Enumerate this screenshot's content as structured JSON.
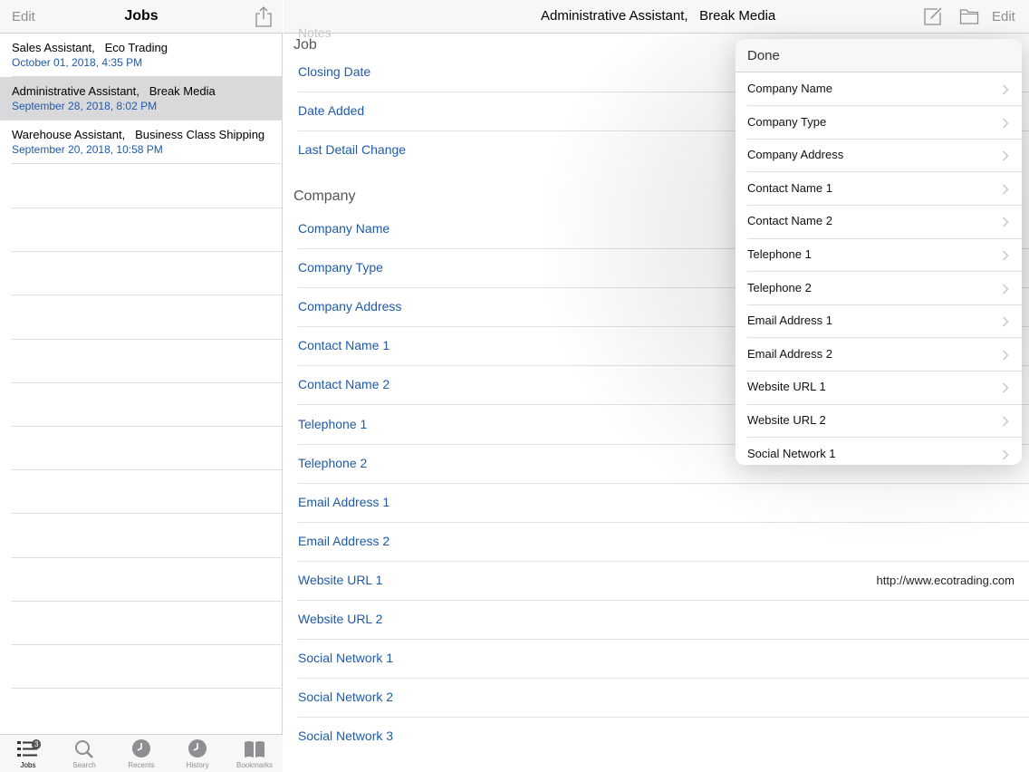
{
  "left": {
    "edit_label": "Edit",
    "title": "Jobs",
    "share_icon": "share-icon",
    "jobs": [
      {
        "title": "Sales Assistant,   Eco Trading",
        "date": "October 01, 2018, 4:35 PM",
        "selected": false
      },
      {
        "title": "Administrative Assistant,   Break Media",
        "date": "September 28, 2018, 8:02 PM",
        "selected": true
      },
      {
        "title": "Warehouse Assistant,   Business Class Shipping",
        "date": "September 20, 2018, 10:58 PM",
        "selected": false
      }
    ],
    "tabs": [
      {
        "label": "Jobs",
        "icon": "list-icon",
        "badge": "3",
        "active": true
      },
      {
        "label": "Search",
        "icon": "magnifier-icon",
        "active": false
      },
      {
        "label": "Recents",
        "icon": "clock-icon",
        "active": false
      },
      {
        "label": "History",
        "icon": "clock-icon",
        "active": false
      },
      {
        "label": "Bookmarks",
        "icon": "book-icon",
        "active": false
      }
    ]
  },
  "right": {
    "title": "Administrative Assistant,   Break Media",
    "edit_label": "Edit",
    "compose_icon": "compose-icon",
    "folder_icon": "folder-icon",
    "notes_ghost": "Notes",
    "sections": [
      {
        "header": "Job",
        "fields": [
          {
            "label": "Closing Date",
            "value": ""
          },
          {
            "label": "Date Added",
            "value": ""
          },
          {
            "label": "Last Detail Change",
            "value": ""
          }
        ]
      },
      {
        "header": "Company",
        "fields": [
          {
            "label": "Company Name",
            "value": ""
          },
          {
            "label": "Company Type",
            "value": ""
          },
          {
            "label": "Company Address",
            "value": ""
          },
          {
            "label": "Contact Name 1",
            "value": ""
          },
          {
            "label": "Contact Name 2",
            "value": ""
          },
          {
            "label": "Telephone 1",
            "value": ""
          },
          {
            "label": "Telephone 2",
            "value": ""
          },
          {
            "label": "Email Address 1",
            "value": ""
          },
          {
            "label": "Email Address 2",
            "value": ""
          },
          {
            "label": "Website URL 1",
            "value": "http://www.ecotrading.com"
          },
          {
            "label": "Website URL 2",
            "value": ""
          },
          {
            "label": "Social Network 1",
            "value": ""
          },
          {
            "label": "Social Network 2",
            "value": ""
          },
          {
            "label": "Social Network 3",
            "value": ""
          }
        ]
      }
    ]
  },
  "popover": {
    "done_label": "Done",
    "items": [
      "Company Name",
      "Company Type",
      "Company Address",
      "Contact Name 1",
      "Contact Name 2",
      "Telephone 1",
      "Telephone 2",
      "Email Address 1",
      "Email Address 2",
      "Website URL 1",
      "Website URL 2",
      "Social Network 1"
    ]
  }
}
